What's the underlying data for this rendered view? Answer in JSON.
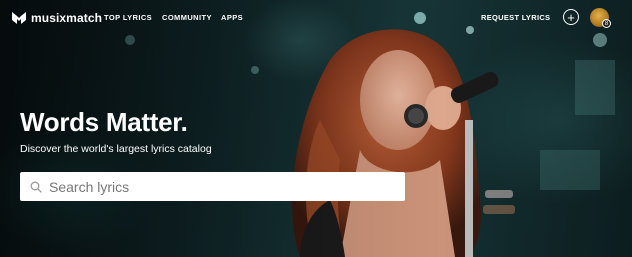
{
  "brand": {
    "name": "musixmatch"
  },
  "nav": {
    "links": [
      "TOP LYRICS",
      "COMMUNITY",
      "APPS"
    ],
    "request_label": "REQUEST LYRICS",
    "plus_label": "+",
    "avatar_badge": "8"
  },
  "hero": {
    "headline": "Words Matter.",
    "subhead": "Discover the world's largest lyrics catalog"
  },
  "search": {
    "placeholder": "Search lyrics"
  },
  "colors": {
    "text": "#ffffff",
    "search_bg": "#ffffff",
    "overlay": "#0c1a1c"
  }
}
